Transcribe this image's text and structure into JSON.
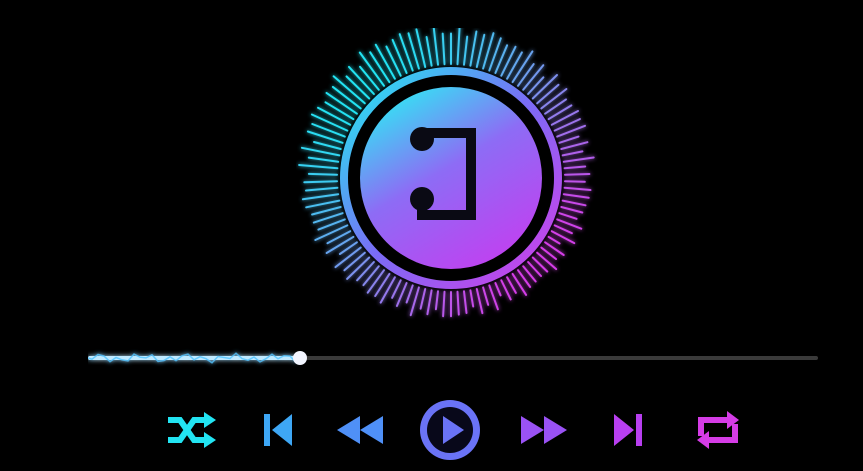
{
  "player": {
    "progress": 0.29,
    "colors": {
      "cyan": "#22e4f2",
      "sky": "#3ea7f5",
      "blue": "#5d7cf7",
      "violet": "#8b5cf7",
      "purple": "#b83ff0",
      "magenta": "#d53ce6",
      "track": "#3a3a3a",
      "knob": "#f2f5ff"
    },
    "icons": {
      "logo": "music-note-icon",
      "shuffle": "shuffle-icon",
      "skip_previous": "skip-previous-icon",
      "rewind": "rewind-icon",
      "play": "play-icon",
      "fast_forward": "fast-forward-icon",
      "skip_next": "skip-next-icon",
      "repeat": "repeat-icon"
    }
  }
}
